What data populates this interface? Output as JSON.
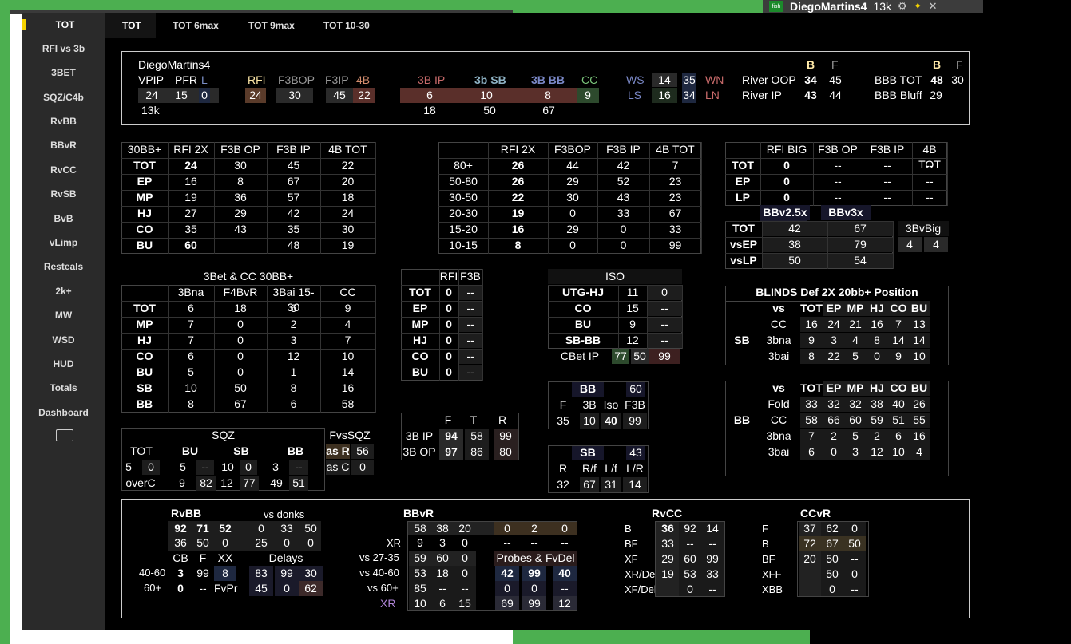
{
  "topbar": {
    "player": "DiegoMartins4",
    "hands": "13k",
    "logo": "fish"
  },
  "sidebar": {
    "items": [
      "TOT",
      "RFI vs 3b",
      "3BET",
      "SQZ/C4b",
      "RvBB",
      "BBvR",
      "RvCC",
      "RvSB",
      "BvB",
      "vLimp",
      "Resteals",
      "2k+",
      "MW",
      "WSD",
      "HUD",
      "Totals",
      "Dashboard"
    ]
  },
  "tabs": [
    "TOT",
    "TOT 6max",
    "TOT 9max",
    "TOT 10-30"
  ],
  "header": {
    "player": "DiegoMartins4",
    "vpip_l": "VPIP",
    "pfr_l": "PFR",
    "l_l": "L",
    "vpip": "24",
    "pfr": "15",
    "l": "0",
    "hands": "13k",
    "rfi_l": "RFI",
    "f3bop_l": "F3BOP",
    "f3ip_l": "F3IP",
    "b4_l": "4B",
    "rfi": "24",
    "f3bop": "30",
    "f3ip": "45",
    "b4": "22",
    "ip3b_l": "3B IP",
    "sb3b_l": "3b SB",
    "bb3b_l": "3B BB",
    "cc_l": "CC",
    "ip3b": "6",
    "sb3b": "10",
    "bb3b": "8",
    "cc": "9",
    "sub1": "18",
    "sub2": "50",
    "sub3": "67",
    "ws_l": "WS",
    "ws1": "14",
    "ws2": "35",
    "wn_l": "WN",
    "ls_l": "LS",
    "ls1": "16",
    "ls2": "34",
    "ln_l": "LN",
    "b_l": "B",
    "f_l": "F",
    "roop_l": "River OOP",
    "roop_b": "34",
    "roop_f": "45",
    "rip_l": "River IP",
    "rip_b": "43",
    "rip_f": "44",
    "bbbtot_l": "BBB TOT",
    "bbbtot_b": "48",
    "bbbtot_f": "30",
    "bbbbluff_l": "BBB Bluff",
    "bbbbluff_b": "29"
  },
  "t30bb": {
    "head": [
      "30BB+",
      "RFI 2X",
      "F3B OP",
      "F3B IP",
      "4B TOT"
    ],
    "rows": [
      [
        "TOT",
        "24",
        "30",
        "45",
        "22"
      ],
      [
        "EP",
        "16",
        "8",
        "67",
        "20"
      ],
      [
        "MP",
        "19",
        "36",
        "57",
        "18"
      ],
      [
        "HJ",
        "27",
        "29",
        "42",
        "24"
      ],
      [
        "CO",
        "35",
        "43",
        "35",
        "30"
      ],
      [
        "BU",
        "60",
        "",
        "48",
        "19"
      ]
    ]
  },
  "tdepth": {
    "head": [
      "",
      "RFI 2X",
      "F3BOP",
      "F3B IP",
      "4B TOT"
    ],
    "rows": [
      [
        "80+",
        "26",
        "44",
        "42",
        "7"
      ],
      [
        "50-80",
        "26",
        "29",
        "52",
        "23"
      ],
      [
        "30-50",
        "22",
        "30",
        "43",
        "23"
      ],
      [
        "20-30",
        "19",
        "0",
        "33",
        "67"
      ],
      [
        "15-20",
        "16",
        "29",
        "0",
        "33"
      ],
      [
        "10-15",
        "8",
        "0",
        "0",
        "99"
      ]
    ]
  },
  "tbig": {
    "head": [
      "",
      "RFI BIG",
      "F3B OP",
      "F3B IP",
      "4B TOT"
    ],
    "rows": [
      [
        "TOT",
        "0",
        "--",
        "--",
        "--"
      ],
      [
        "EP",
        "0",
        "--",
        "--",
        "--"
      ],
      [
        "LP",
        "0",
        "--",
        "--",
        "--"
      ]
    ]
  },
  "bbv": {
    "h1": "BBv2.5x",
    "h2": "BBv3x",
    "rows": [
      [
        "TOT",
        "42",
        "67"
      ],
      [
        "vsEP",
        "38",
        "79"
      ],
      [
        "vsLP",
        "50",
        "54"
      ]
    ]
  },
  "b3big": {
    "title": "3BvBig",
    "v1": "4",
    "v2": "4"
  },
  "t3bet": {
    "title": "3Bet & CC 30BB+",
    "head": [
      "",
      "3Bna",
      "F4BvR",
      "3Bai 15-30",
      "CC"
    ],
    "rows": [
      [
        "TOT",
        "6",
        "18",
        "6",
        "9"
      ],
      [
        "MP",
        "7",
        "0",
        "2",
        "4"
      ],
      [
        "HJ",
        "7",
        "0",
        "3",
        "7"
      ],
      [
        "CO",
        "6",
        "0",
        "12",
        "10"
      ],
      [
        "BU",
        "5",
        "0",
        "1",
        "14"
      ],
      [
        "SB",
        "10",
        "50",
        "8",
        "16"
      ],
      [
        "BB",
        "8",
        "67",
        "6",
        "58"
      ]
    ]
  },
  "trfi": {
    "head": [
      "",
      "RFI",
      "F3B"
    ],
    "rows": [
      [
        "TOT",
        "0",
        "--"
      ],
      [
        "EP",
        "0",
        "--"
      ],
      [
        "MP",
        "0",
        "--"
      ],
      [
        "HJ",
        "0",
        "--"
      ],
      [
        "CO",
        "0",
        "--"
      ],
      [
        "BU",
        "0",
        "--"
      ]
    ]
  },
  "iso": {
    "title": "ISO",
    "rows": [
      [
        "UTG-HJ",
        "11",
        "0"
      ],
      [
        "CO",
        "15",
        "--"
      ],
      [
        "BU",
        "9",
        "--"
      ],
      [
        "SB-BB",
        "12",
        "--"
      ]
    ],
    "cbet": [
      "CBet IP",
      "77",
      "50",
      "99"
    ]
  },
  "blinds": {
    "title": "BLINDS  Def  2X  20bb+  Position",
    "head": [
      "vs",
      "TOT",
      "EP",
      "MP",
      "HJ",
      "CO",
      "BU"
    ],
    "pos": "SB",
    "rows": [
      [
        "CC",
        "16",
        "24",
        "21",
        "16",
        "7",
        "13"
      ],
      [
        "3bna",
        "9",
        "3",
        "4",
        "8",
        "14",
        "14"
      ],
      [
        "3bai",
        "8",
        "22",
        "5",
        "0",
        "9",
        "10"
      ]
    ]
  },
  "bbblind": {
    "pos": "BB",
    "head": [
      "vs",
      "TOT",
      "EP",
      "MP",
      "HJ",
      "CO",
      "BU"
    ],
    "rows": [
      [
        "Fold",
        "33",
        "32",
        "32",
        "38",
        "40",
        "26"
      ],
      [
        "CC",
        "58",
        "66",
        "60",
        "59",
        "51",
        "55"
      ],
      [
        "3bna",
        "7",
        "2",
        "5",
        "2",
        "6",
        "16"
      ],
      [
        "3bai",
        "6",
        "0",
        "3",
        "12",
        "10",
        "4"
      ]
    ]
  },
  "sqz": {
    "title": "SQZ",
    "fvs": "FvsSQZ",
    "h": [
      "TOT",
      "BU",
      "SB",
      "BB"
    ],
    "r1": [
      "5",
      "0",
      "5",
      "--",
      "10",
      "0",
      "3",
      "--"
    ],
    "asr": "as R",
    "asr_v": "56",
    "asc": "as C",
    "asc_v": "0",
    "overc": "overC",
    "oc": [
      "9",
      "82",
      "12",
      "77",
      "49",
      "51"
    ]
  },
  "ftr": {
    "head": [
      "",
      "F",
      "T",
      "R"
    ],
    "rows": [
      [
        "3B IP",
        "94",
        "58",
        "99"
      ],
      [
        "3B OP",
        "97",
        "86",
        "80"
      ]
    ]
  },
  "bbmini": {
    "t": "BB",
    "v": "60",
    "head": [
      "F",
      "3B",
      "Iso",
      "F3B"
    ],
    "row": [
      "35",
      "10",
      "40",
      "99"
    ]
  },
  "sbmini": {
    "t": "SB",
    "v": "43",
    "head": [
      "R",
      "R/f",
      "L/f",
      "L/R"
    ],
    "row": [
      "32",
      "67",
      "31",
      "14"
    ]
  },
  "rvbb": {
    "title": "RvBB",
    "vsd": "vs donks",
    "r1": [
      "92",
      "71",
      "52",
      "0",
      "33",
      "50"
    ],
    "r2": [
      "36",
      "50",
      "0",
      "25",
      "0",
      "0"
    ],
    "h": [
      "CB",
      "F",
      "XX",
      "Delays"
    ],
    "l1": "40-60",
    "r3": [
      "3",
      "99",
      "8",
      "83",
      "99",
      "30"
    ],
    "l2": "60+",
    "r4": [
      "0",
      "--",
      "FvPr",
      "45",
      "0",
      "62"
    ]
  },
  "bbvr": {
    "title": "BBvR",
    "r1": [
      "58",
      "38",
      "20",
      "0",
      "2",
      "0"
    ],
    "xr": "XR",
    "r2": [
      "9",
      "3",
      "0",
      "--",
      "--",
      "--"
    ],
    "l3": "vs 27-35",
    "r3": [
      "59",
      "60",
      "0"
    ],
    "probes": "Probes & FvDel",
    "l4": "vs 40-60",
    "r4": [
      "53",
      "18",
      "0",
      "42",
      "99",
      "40"
    ],
    "l5": "vs 60+",
    "r5": [
      "85",
      "--",
      "--",
      "0",
      "0",
      "--"
    ],
    "l6": "XR",
    "r6": [
      "10",
      "6",
      "15",
      "69",
      "99",
      "12"
    ]
  },
  "rvcc": {
    "title": "RvCC",
    "rows": [
      [
        "B",
        "36",
        "92",
        "14"
      ],
      [
        "BF",
        "33",
        "--",
        "--"
      ],
      [
        "XF",
        "29",
        "60",
        "99"
      ],
      [
        "XR/Del",
        "19",
        "53",
        "33"
      ],
      [
        "XF/Del",
        "",
        "0",
        "--"
      ]
    ]
  },
  "ccvr": {
    "title": "CCvR",
    "rows": [
      [
        "F",
        "37",
        "62",
        "0"
      ],
      [
        "B",
        "72",
        "67",
        "50"
      ],
      [
        "BF",
        "20",
        "50",
        "--"
      ],
      [
        "XFF",
        "",
        "50",
        "0"
      ],
      [
        "XBB",
        "",
        "0",
        "--"
      ]
    ]
  }
}
